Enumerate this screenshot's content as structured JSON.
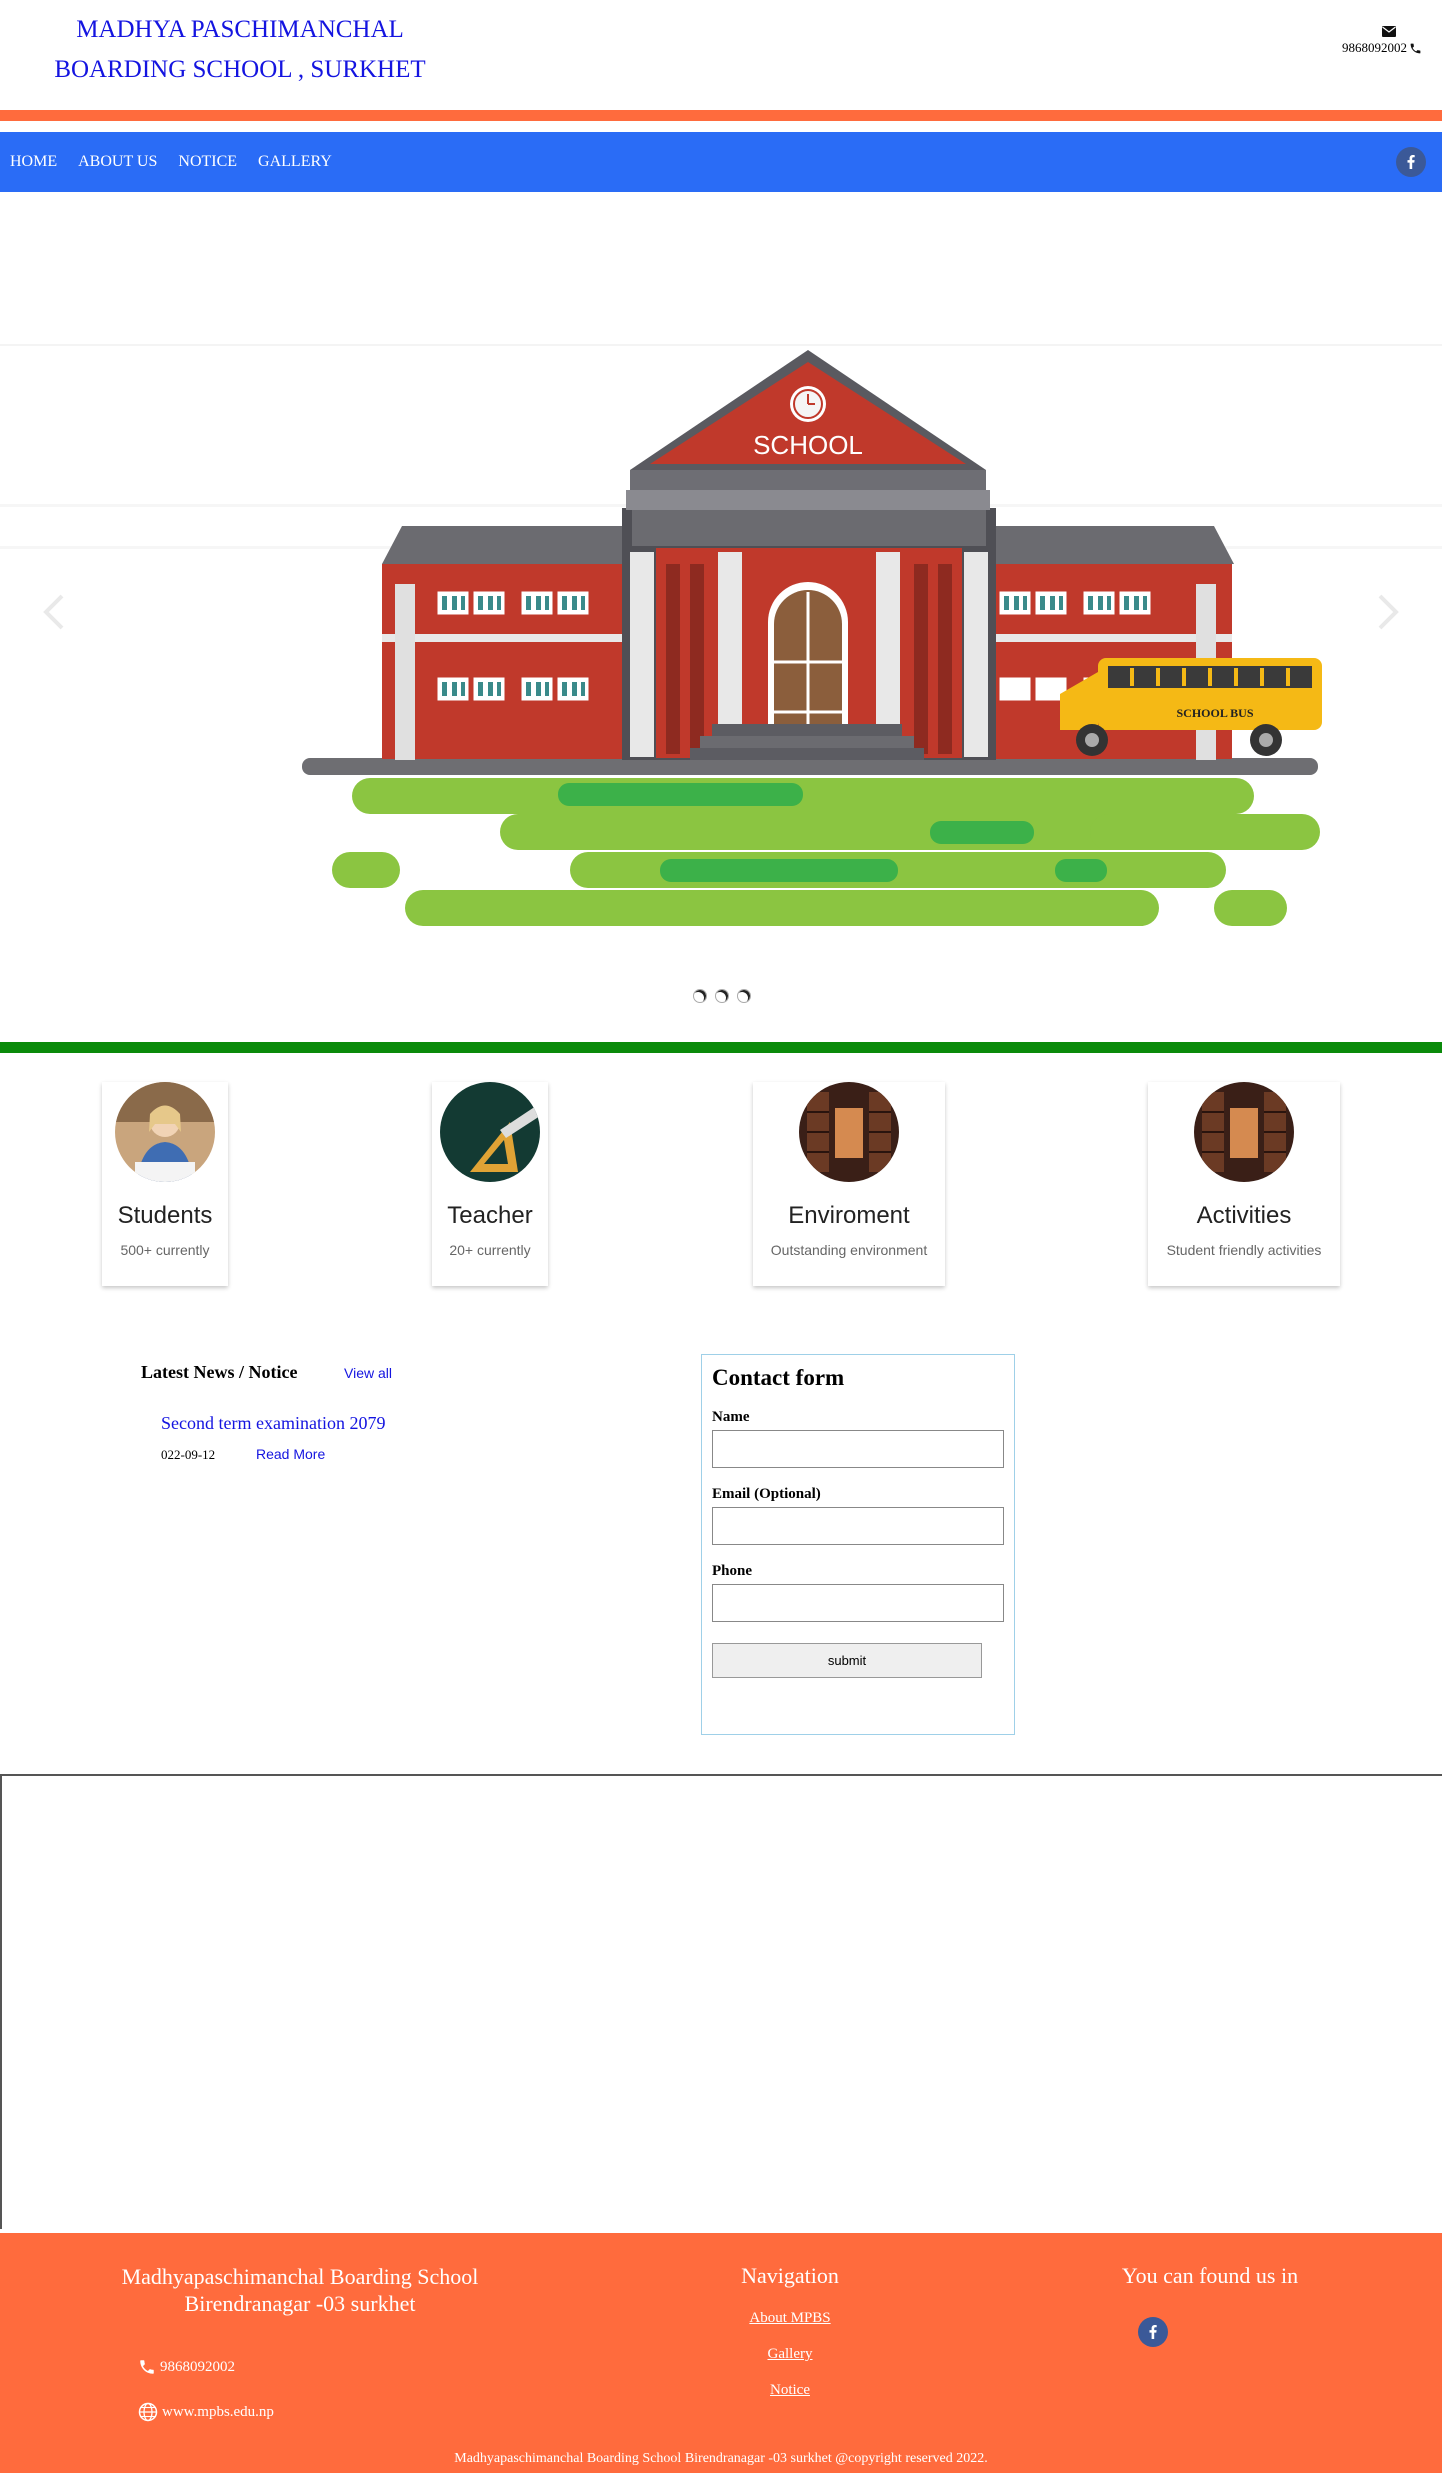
{
  "header": {
    "school_name_line1": "MADHYA PASCHIMANCHAL",
    "school_name_line2": "BOARDING SCHOOL , SURKHET",
    "phone": "9868092002"
  },
  "nav": {
    "items": [
      {
        "label": "HOME"
      },
      {
        "label": "ABOUT US"
      },
      {
        "label": "NOTICE"
      },
      {
        "label": "GALLERY"
      }
    ],
    "social_icon": "facebook-icon"
  },
  "hero": {
    "sign_text": "SCHOOL",
    "bus_text": "SCHOOL BUS",
    "slide_count": 3
  },
  "cards": [
    {
      "title": "Students",
      "sub": "500+ currently"
    },
    {
      "title": "Teacher",
      "sub": "20+ currently"
    },
    {
      "title": "Enviroment",
      "sub": "Outstanding environment"
    },
    {
      "title": "Activities",
      "sub": "Student friendly activities"
    }
  ],
  "news": {
    "heading": "Latest News / Notice",
    "view_all": "View all",
    "items": [
      {
        "title": "Second term examination 2079",
        "date": "022-09-12",
        "read_more": "Read More"
      }
    ]
  },
  "contact_form": {
    "title": "Contact form",
    "name_label": "Name",
    "email_label": "Email (Optional)",
    "phone_label": "Phone",
    "submit_label": "submit"
  },
  "footer": {
    "school_name": "Madhyapaschimanchal Boarding School Birendranagar -03 surkhet",
    "phone": "9868092002",
    "website": "www.mpbs.edu.np",
    "nav_title": "Navigation",
    "links": [
      {
        "label": "About MPBS"
      },
      {
        "label": "Gallery"
      },
      {
        "label": "Notice"
      }
    ],
    "found_title": "You can found us in",
    "copyright": "Madhyapaschimanchal Boarding School Birendranagar -03 surkhet @copyright reserved 2022."
  },
  "colors": {
    "accent_orange": "#ff6b3d",
    "nav_blue": "#2a6cf6",
    "divider_green": "#0a8a0a",
    "link_blue": "#1414e0",
    "facebook_blue": "#3b5998"
  }
}
